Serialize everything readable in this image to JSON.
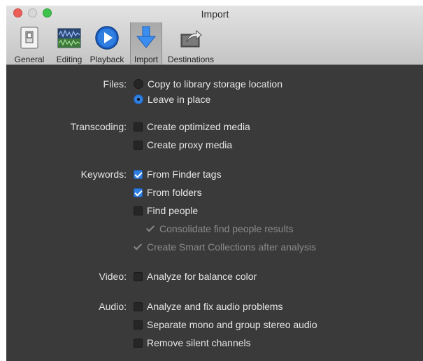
{
  "window": {
    "title": "Import"
  },
  "toolbar": {
    "tabs": [
      {
        "label": "General",
        "icon": "general-switch-icon"
      },
      {
        "label": "Editing",
        "icon": "editing-waveform-icon"
      },
      {
        "label": "Playback",
        "icon": "playback-play-icon"
      },
      {
        "label": "Import",
        "icon": "import-arrow-icon",
        "active": true
      },
      {
        "label": "Destinations",
        "icon": "destinations-share-icon"
      }
    ]
  },
  "files": {
    "label": "Files:",
    "options": [
      {
        "label": "Copy to library storage location",
        "selected": false
      },
      {
        "label": "Leave in place",
        "selected": true
      }
    ]
  },
  "transcoding": {
    "label": "Transcoding:",
    "options": [
      {
        "label": "Create optimized media",
        "checked": false
      },
      {
        "label": "Create proxy media",
        "checked": false
      }
    ]
  },
  "keywords": {
    "label": "Keywords:",
    "options": [
      {
        "label": "From Finder tags",
        "checked": true
      },
      {
        "label": "From folders",
        "checked": true
      },
      {
        "label": "Find people",
        "checked": false
      },
      {
        "label": "Consolidate find people results",
        "checked": true,
        "disabled": true
      },
      {
        "label": "Create Smart Collections after analysis",
        "checked": true,
        "disabled": true
      }
    ]
  },
  "video": {
    "label": "Video:",
    "options": [
      {
        "label": "Analyze for balance color",
        "checked": false
      }
    ]
  },
  "audio": {
    "label": "Audio:",
    "options": [
      {
        "label": "Analyze and fix audio problems",
        "checked": false
      },
      {
        "label": "Separate mono and group stereo audio",
        "checked": false
      },
      {
        "label": "Remove silent channels",
        "checked": false
      }
    ]
  },
  "colors": {
    "accent": "#2f7ee0",
    "panel": "#3a3a3a",
    "toolbar": "#d4d4d4"
  }
}
